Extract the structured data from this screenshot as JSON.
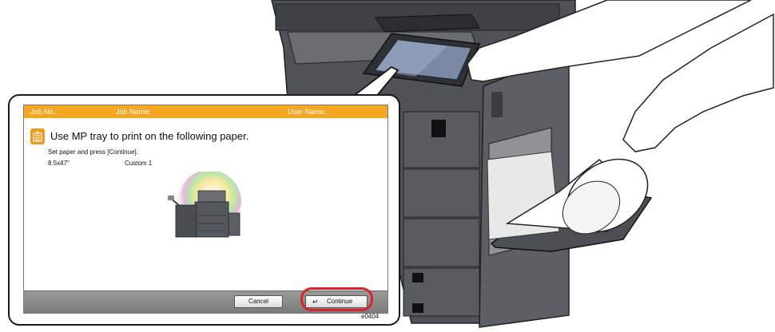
{
  "screen": {
    "header": {
      "job_no": "Job No.:",
      "job_name": "Job Name:",
      "user_name": "User Name:"
    },
    "message_title": "Use MP tray to print on the following paper.",
    "instruction": "Set paper and press [Continue].",
    "paper_size": "8.5x47\"",
    "paper_type": "Custom 1",
    "buttons": {
      "cancel": "Cancel",
      "continue": "Continue"
    }
  },
  "figure_code": "e0404",
  "colors": {
    "header_bar": "#f5a623",
    "highlight_ring": "#d8252b",
    "machine_body": "#5f6367"
  },
  "icons": {
    "message": "paper-tray-icon",
    "continue_button": "return-arrow-icon"
  }
}
